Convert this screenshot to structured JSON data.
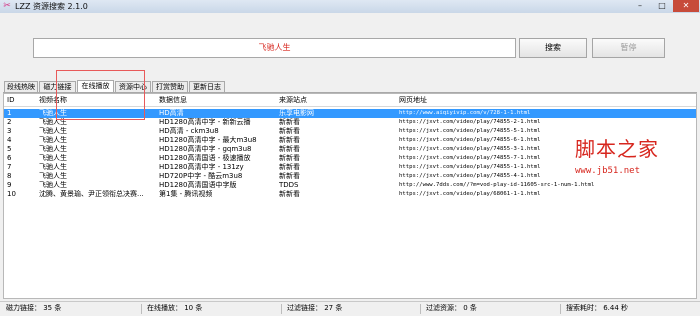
{
  "window": {
    "title": "LZZ 资源搜索 2.1.0",
    "icon": "app-logo-icon",
    "controls": [
      "–",
      "□",
      "✕"
    ]
  },
  "search": {
    "value": "飞驰人生",
    "search_label": "搜索",
    "stop_label": "暂停"
  },
  "tabs": [
    {
      "label": "段线热映"
    },
    {
      "label": "磁力链接"
    },
    {
      "label": "在线播放",
      "active": true
    },
    {
      "label": "资源中心"
    },
    {
      "label": "打赏赞助"
    },
    {
      "label": "更新日志"
    }
  ],
  "table": {
    "headers": [
      "ID",
      "视频名称",
      "数据信息",
      "来源站点",
      "网页地址"
    ],
    "rows": [
      {
        "id": "1",
        "name": "飞驰人生",
        "info": "HD高清",
        "source": "乐享电影网",
        "url": "http://www.aiqiyivip.com/v/728-1-1.html",
        "selected": true
      },
      {
        "id": "2",
        "name": "飞驰人生",
        "info": "HD1280高清中字 - 新新云播",
        "source": "新新看",
        "url": "https://jxvt.com/video/play/74855-2-1.html"
      },
      {
        "id": "3",
        "name": "飞驰人生",
        "info": "HD高清 - ckm3u8",
        "source": "新新看",
        "url": "https://jxvt.com/video/play/74855-5-1.html"
      },
      {
        "id": "4",
        "name": "飞驰人生",
        "info": "HD1280高清中字 - 最大m3u8",
        "source": "新新看",
        "url": "https://jxvt.com/video/play/74855-6-1.html"
      },
      {
        "id": "5",
        "name": "飞驰人生",
        "info": "HD1280高清中字 - gqm3u8",
        "source": "新新看",
        "url": "https://jxvt.com/video/play/74855-3-1.html"
      },
      {
        "id": "6",
        "name": "飞驰人生",
        "info": "HD1280高清国语 - 极速播放",
        "source": "新新看",
        "url": "https://jxvt.com/video/play/74855-7-1.html"
      },
      {
        "id": "7",
        "name": "飞驰人生",
        "info": "HD1280高清中字 - 131zy",
        "source": "新新看",
        "url": "https://jxvt.com/video/play/74855-1-1.html"
      },
      {
        "id": "8",
        "name": "飞驰人生",
        "info": "HD720P中字 - 酷云m3u8",
        "source": "新新看",
        "url": "https://jxvt.com/video/play/74855-4-1.html"
      },
      {
        "id": "9",
        "name": "飞驰人生",
        "info": "HD1280高清国语中字版",
        "source": "TDDS",
        "url": "http://www.7dds.com//?m=vod-play-id-11605-src-1-num-1.html"
      },
      {
        "id": "10",
        "name": "沈腾、黄景瑜、尹正领衔总决赛...",
        "info": "第1集 - 腾讯视频",
        "source": "新新看",
        "url": "https://jxvt.com/video/play/68061-1-1.html"
      }
    ]
  },
  "watermark": {
    "title": "脚本之家",
    "url": "www.jb51.net"
  },
  "status": {
    "magnet": "磁力链接： 35  条",
    "online": "在线播放： 10  条",
    "filter_links": "过滤链接： 27  条",
    "filter_resources": "过滤资源： 0  条",
    "elapsed": "搜索耗时： 6.44  秒"
  }
}
